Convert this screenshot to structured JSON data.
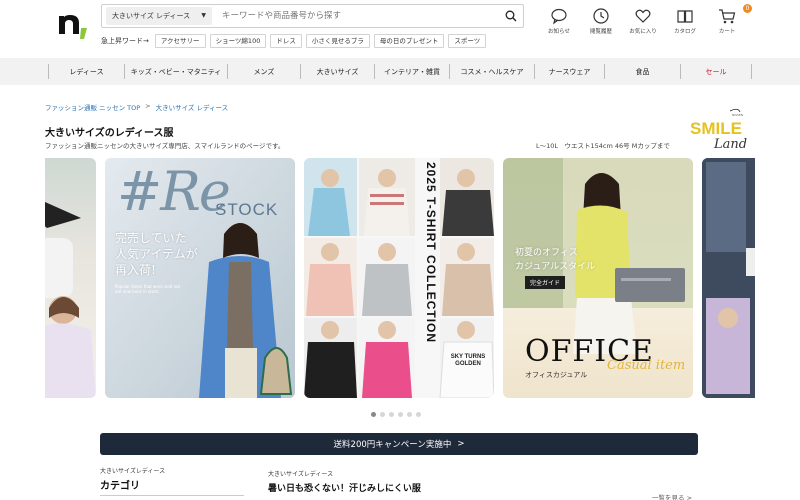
{
  "header": {
    "search": {
      "category": "大きいサイズ レディース",
      "placeholder": "キーワードや商品番号から探す"
    },
    "icons": [
      {
        "label": "お知らせ",
        "icon": "chat-bubble-icon"
      },
      {
        "label": "閲覧履歴",
        "icon": "clock-icon"
      },
      {
        "label": "お気に入り",
        "icon": "heart-icon"
      },
      {
        "label": "カタログ",
        "icon": "catalog-book-icon"
      },
      {
        "label": "カート",
        "icon": "cart-icon",
        "badge": "0"
      }
    ],
    "hot_words": {
      "label": "急上昇ワード→",
      "items": [
        "アクセサリー",
        "ショーツ綿100",
        "ドレス",
        "小さく見せるブラ",
        "母の日のプレゼント",
        "スポーツ"
      ]
    }
  },
  "nav": {
    "items": [
      "レディース",
      "キッズ・ベビー・マタニティ",
      "メンズ",
      "大きいサイズ",
      "インテリア・雑貨",
      "コスメ・ヘルスケア",
      "ナースウェア",
      "食品",
      "セール"
    ]
  },
  "breadcrumb": {
    "items": [
      "ファッション通販 ニッセン TOP",
      "大きいサイズ レディース"
    ],
    "separator": ">"
  },
  "page": {
    "title": "大きいサイズのレディース服",
    "description": "ファッション通販ニッセンの大きいサイズ専門店、スマイルランドのページです。",
    "size_info": "L～10L　ウエスト154cm 46号 Mカップまで",
    "brand_logo": {
      "main": "SMILE",
      "script": "Land",
      "tiny": "NISSEN"
    }
  },
  "carousel": {
    "slides": [
      {
        "id": "restock",
        "hash": "#",
        "big": "Re",
        "stock": "STOCK",
        "copy": "完売していた\n人気アイテムが\n再入荷!",
        "small": "Popular items that were sold out are now back in stock."
      },
      {
        "id": "tshirt",
        "vertical": "2025 T-SHIRT COLLECTION",
        "print_1": "SKY TURNS GOLDEN"
      },
      {
        "id": "office",
        "copy": "初夏のオフィス\nカジュアルスタイル",
        "badge": "完全ガイド",
        "big": "OFFICE",
        "small": "オフィスカジュアル",
        "script": "Casual item"
      }
    ],
    "dots": 6,
    "active_dot": 0
  },
  "campaign": {
    "label": "送料200円キャンペーン実施中",
    "arrow": ">"
  },
  "bottom": {
    "category_eyebrow": "大きいサイズレディース",
    "category_title": "カテゴリ",
    "feature_eyebrow": "大きいサイズレディース",
    "feature_title": "暑い日も恐くない！汗じみしにくい服",
    "more": "一覧を見る >"
  },
  "colors": {
    "sale": "#c8102e",
    "link": "#2a6fb0",
    "campaign_bg": "#1e2a3a",
    "logo_green": "#8cc63f",
    "brand_yellow": "#e6c21e"
  }
}
